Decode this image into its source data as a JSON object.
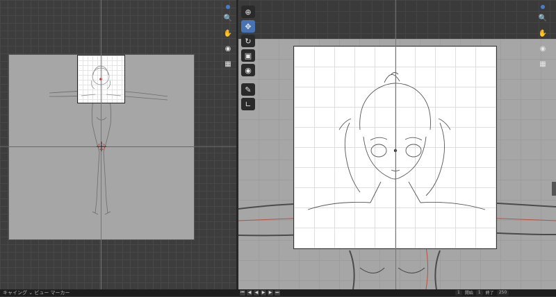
{
  "statusbar": {
    "left_text": "キャイング ⌄ ビュー マーカー",
    "frame_current": "1",
    "frame_start_label": "開始",
    "frame_start": "1",
    "frame_end_label": "終了",
    "frame_end": "250"
  },
  "icons": {
    "left_nav": [
      "zoom-icon",
      "hand-pan-icon",
      "camera-icon",
      "grid-icon"
    ],
    "right_nav": [
      "zoom-icon",
      "hand-pan-icon",
      "camera-icon",
      "grid-icon"
    ],
    "tools": [
      "cursor-icon",
      "move-icon",
      "rotate-icon",
      "scale-icon",
      "transform-icon",
      "annotate-icon",
      "measure-icon"
    ],
    "playback": [
      "jump-start-icon",
      "prev-key-icon",
      "play-reverse-icon",
      "play-icon",
      "next-key-icon",
      "jump-end-icon"
    ]
  },
  "colors": {
    "accent": "#4772b3",
    "axis_x": "#b04a4a",
    "axis_y": "#4e7ac7"
  }
}
